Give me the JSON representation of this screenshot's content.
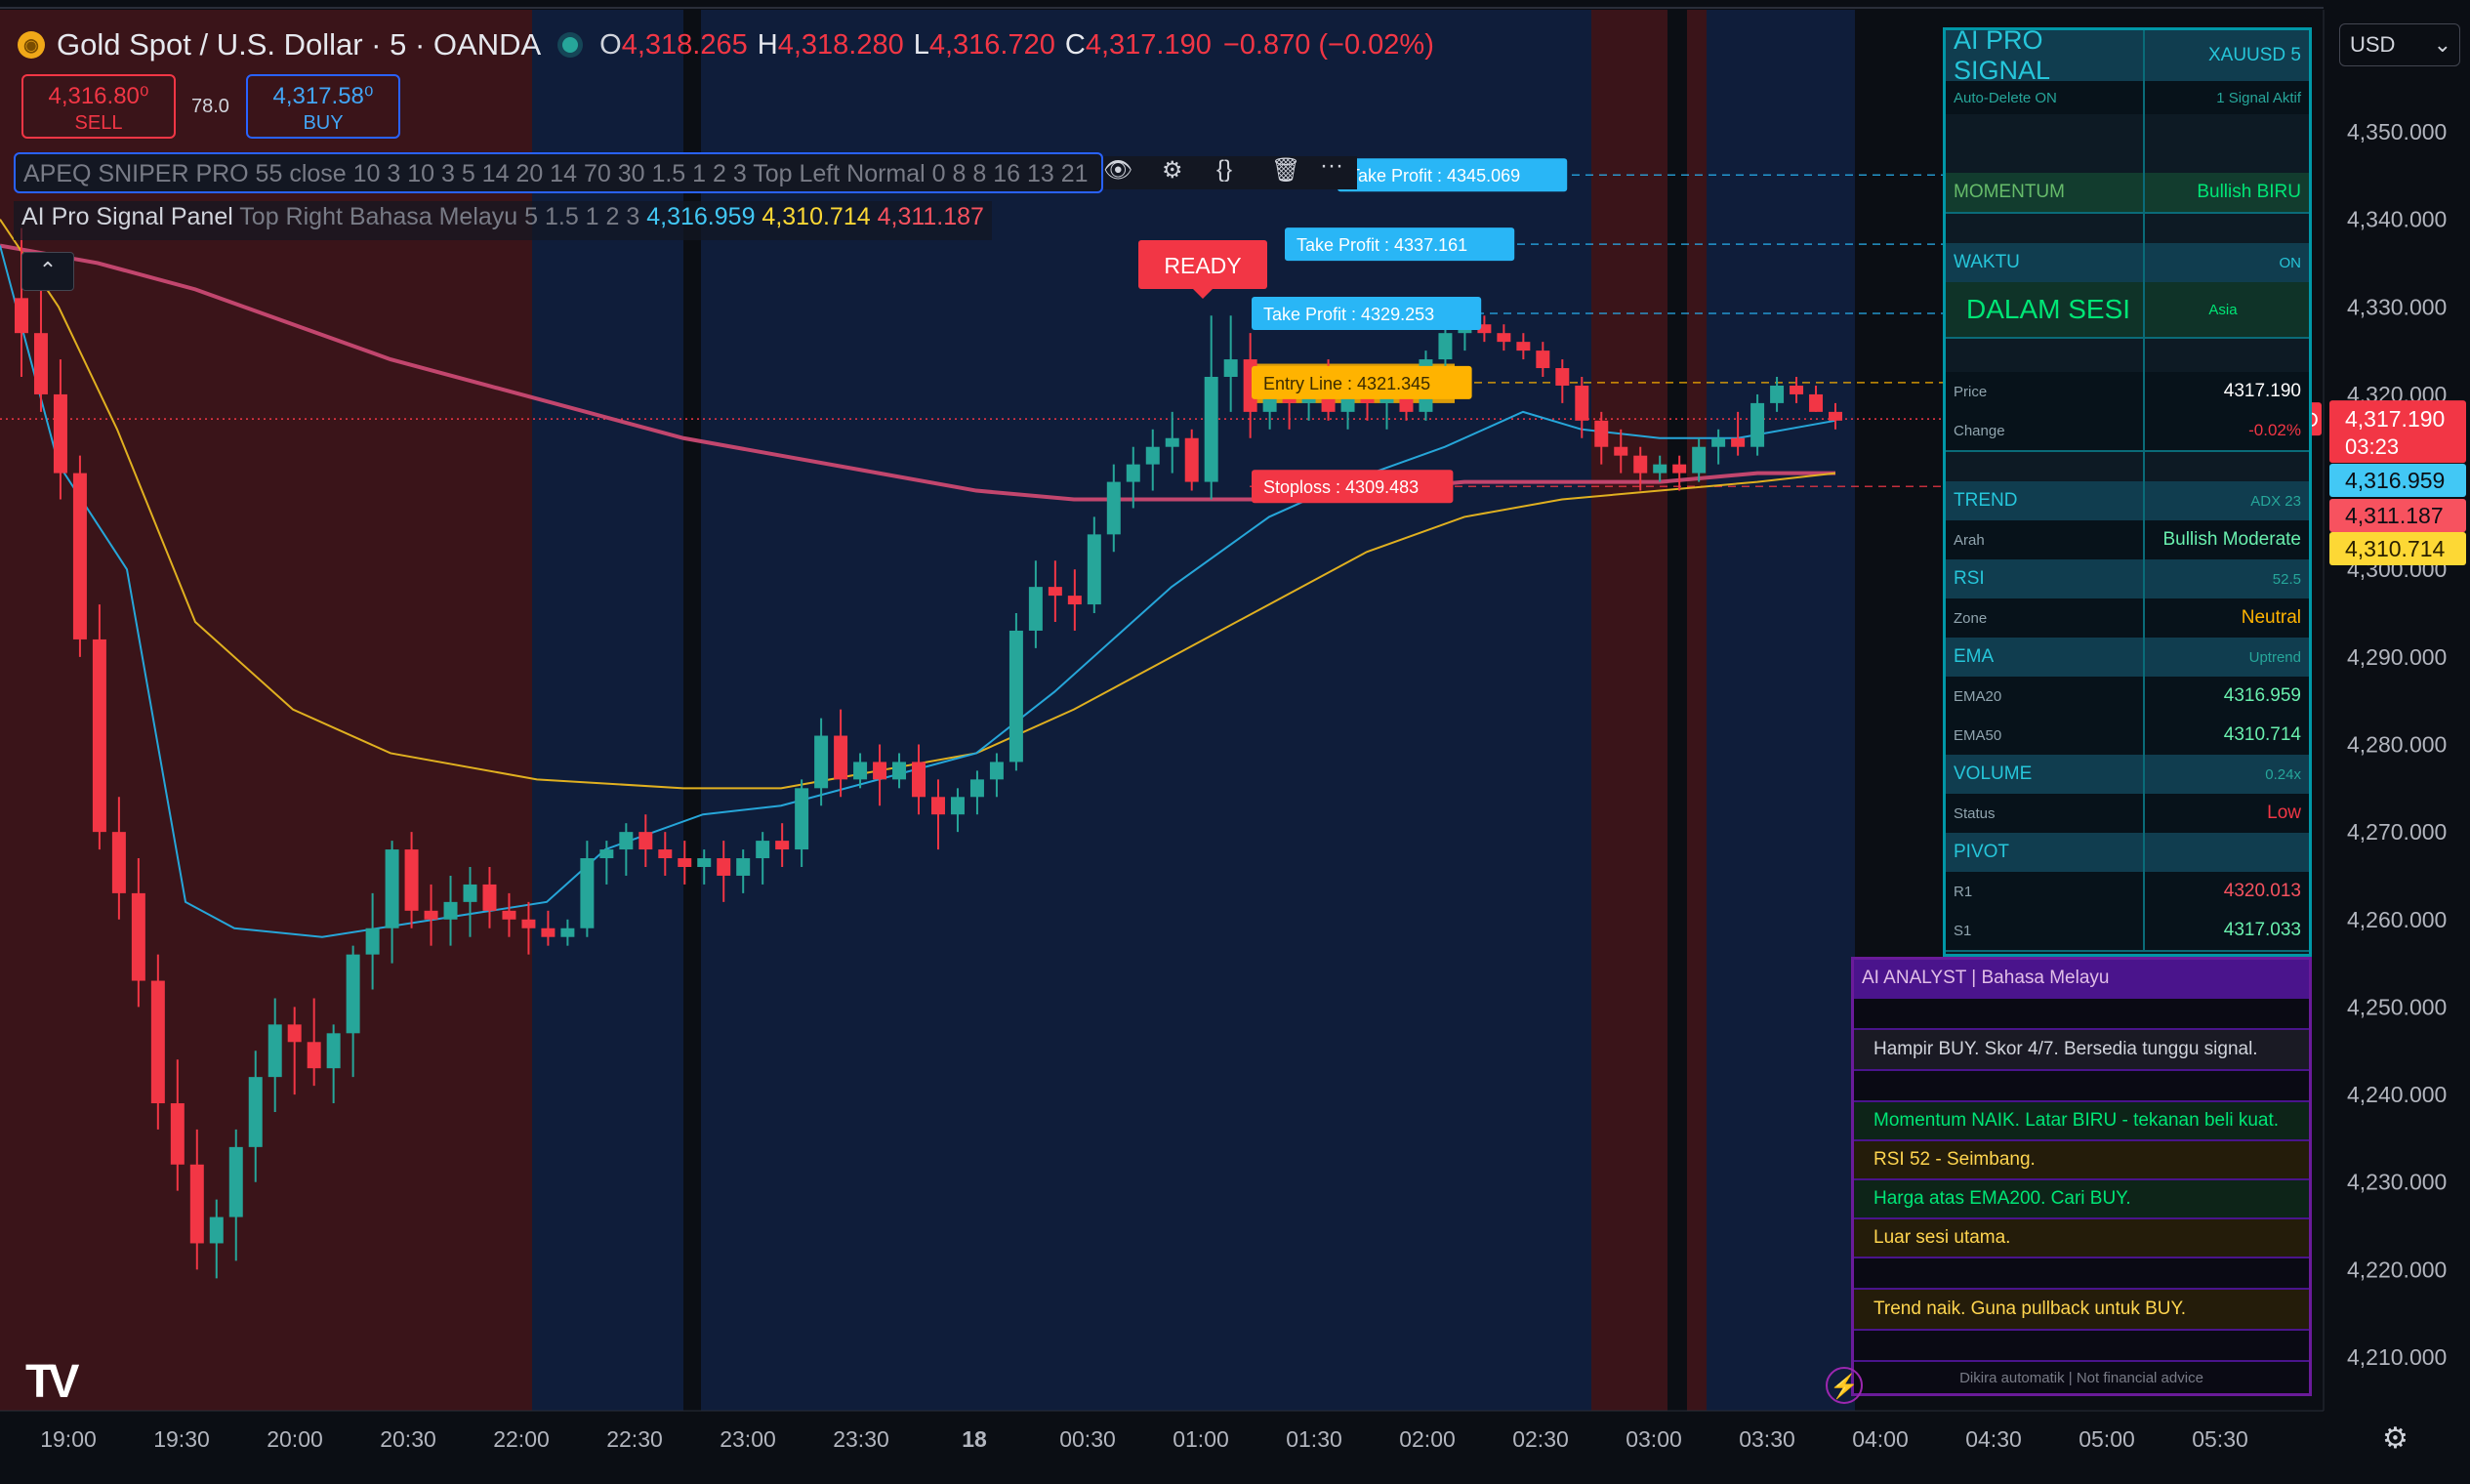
{
  "header": {
    "symbol": "Gold Spot / U.S. Dollar · 5 · OANDA",
    "open_label": "O",
    "open": "4,318.265",
    "high_label": "H",
    "high": "4,318.280",
    "low_label": "L",
    "low": "4,316.720",
    "close_label": "C",
    "close": "4,317.190",
    "change": "−0.870 (−0.02%)"
  },
  "trade": {
    "sell_price": "4,316.80⁰",
    "sell_label": "SELL",
    "spread": "78.0",
    "buy_price": "4,317.58⁰",
    "buy_label": "BUY"
  },
  "indicator1": {
    "text": "APEQ SNIPER PRO 55 close 10 3 10 3 5 14 20 14 70 30 1.5 1 2 3 Top Left Normal 0 8 8 16 13 21"
  },
  "indicator2": {
    "name": "AI Pro Signal Panel",
    "args": "Top Right Bahasa Melayu 5 1.5 1 2 3",
    "v1": "4,316.959",
    "v2": "4,310.714",
    "v3": "4,311.187"
  },
  "currency": "USD",
  "colors": {
    "up": "#26a69a",
    "down": "#f23645",
    "ema20": "#26a6d9",
    "ema50": "#e0b020",
    "ema200": "#c2466e",
    "sessionRed": "#3a1419",
    "sessionBlue": "#0f1d3a"
  },
  "chart_data": {
    "type": "candlestick",
    "symbol": "XAUUSD",
    "interval": "5",
    "ylim": [
      4203,
      4358
    ],
    "y_ticks": [
      "4,350.000",
      "4,340.000",
      "4,330.000",
      "4,320.000",
      "4,300.000",
      "4,290.000",
      "4,280.000",
      "4,270.000",
      "4,260.000",
      "4,250.000",
      "4,240.000",
      "4,230.000",
      "4,220.000",
      "4,210.000"
    ],
    "y_tick_values": [
      4350,
      4340,
      4330,
      4320,
      4300,
      4290,
      4280,
      4270,
      4260,
      4250,
      4240,
      4230,
      4220,
      4210
    ],
    "x_ticks": [
      "19:00",
      "19:30",
      "20:00",
      "20:30",
      "22:00",
      "22:30",
      "23:00",
      "23:30",
      "18",
      "00:30",
      "01:00",
      "01:30",
      "02:00",
      "02:30",
      "03:00",
      "03:30",
      "04:00",
      "04:30",
      "05:00",
      "05:30"
    ],
    "price_levels": [
      {
        "label": "Take Profit : 4345.069",
        "value": 4345.069
      },
      {
        "label": "Take Profit : 4337.161",
        "value": 4337.161
      },
      {
        "label": "Take Profit : 4329.253",
        "value": 4329.253
      },
      {
        "label": "Entry Line : 4321.345",
        "value": 4321.345
      },
      {
        "label": "Stoploss : 4309.483",
        "value": 4309.483
      }
    ],
    "ready_label": "READY",
    "price_tags": [
      {
        "label": "XAUUSD",
        "value": "4,317.190",
        "extra": "03:23",
        "color": "#f23645"
      },
      {
        "label": "",
        "value": "4,316.959",
        "color": "#42c8f5"
      },
      {
        "label": "",
        "value": "4,311.187",
        "color": "#f7525f"
      },
      {
        "label": "",
        "value": "4,310.714",
        "color": "#fdd835"
      }
    ],
    "candles": [
      [
        4331,
        4339,
        4322,
        4327
      ],
      [
        4327,
        4334,
        4318,
        4320
      ],
      [
        4320,
        4324,
        4308,
        4311
      ],
      [
        4311,
        4313,
        4290,
        4292
      ],
      [
        4292,
        4296,
        4268,
        4270
      ],
      [
        4270,
        4274,
        4260,
        4263
      ],
      [
        4263,
        4267,
        4250,
        4253
      ],
      [
        4253,
        4256,
        4236,
        4239
      ],
      [
        4239,
        4244,
        4229,
        4232
      ],
      [
        4232,
        4236,
        4220,
        4223
      ],
      [
        4223,
        4228,
        4219,
        4226
      ],
      [
        4226,
        4236,
        4221,
        4234
      ],
      [
        4234,
        4245,
        4230,
        4242
      ],
      [
        4242,
        4251,
        4238,
        4248
      ],
      [
        4248,
        4250,
        4240,
        4246
      ],
      [
        4246,
        4251,
        4241,
        4243
      ],
      [
        4243,
        4248,
        4239,
        4247
      ],
      [
        4247,
        4257,
        4242,
        4256
      ],
      [
        4256,
        4263,
        4252,
        4259
      ],
      [
        4259,
        4269,
        4255,
        4268
      ],
      [
        4268,
        4270,
        4259,
        4261
      ],
      [
        4261,
        4264,
        4257,
        4260
      ],
      [
        4260,
        4265,
        4257,
        4262
      ],
      [
        4262,
        4266,
        4258,
        4264
      ],
      [
        4264,
        4266,
        4259,
        4261
      ],
      [
        4261,
        4263,
        4258,
        4260
      ],
      [
        4260,
        4262,
        4256,
        4259
      ],
      [
        4259,
        4261,
        4257,
        4258
      ],
      [
        4258,
        4260,
        4257,
        4259
      ],
      [
        4259,
        4269,
        4258,
        4267
      ],
      [
        4267,
        4269,
        4264,
        4268
      ],
      [
        4268,
        4271,
        4265,
        4270
      ],
      [
        4270,
        4272,
        4266,
        4268
      ],
      [
        4268,
        4270,
        4265,
        4267
      ],
      [
        4267,
        4269,
        4264,
        4266
      ],
      [
        4266,
        4268,
        4264,
        4267
      ],
      [
        4267,
        4269,
        4262,
        4265
      ],
      [
        4265,
        4268,
        4263,
        4267
      ],
      [
        4267,
        4270,
        4264,
        4269
      ],
      [
        4269,
        4271,
        4266,
        4268
      ],
      [
        4268,
        4276,
        4266,
        4275
      ],
      [
        4275,
        4283,
        4273,
        4281
      ],
      [
        4281,
        4284,
        4274,
        4276
      ],
      [
        4276,
        4279,
        4275,
        4278
      ],
      [
        4278,
        4280,
        4273,
        4276
      ],
      [
        4276,
        4279,
        4275,
        4278
      ],
      [
        4278,
        4280,
        4272,
        4274
      ],
      [
        4274,
        4276,
        4268,
        4272
      ],
      [
        4272,
        4275,
        4270,
        4274
      ],
      [
        4274,
        4277,
        4272,
        4276
      ],
      [
        4276,
        4279,
        4274,
        4278
      ],
      [
        4278,
        4295,
        4277,
        4293
      ],
      [
        4293,
        4301,
        4291,
        4298
      ],
      [
        4298,
        4301,
        4294,
        4297
      ],
      [
        4297,
        4300,
        4293,
        4296
      ],
      [
        4296,
        4306,
        4295,
        4304
      ],
      [
        4304,
        4312,
        4302,
        4310
      ],
      [
        4310,
        4314,
        4307,
        4312
      ],
      [
        4312,
        4316,
        4309,
        4314
      ],
      [
        4314,
        4318,
        4311,
        4315
      ],
      [
        4315,
        4316,
        4309,
        4310
      ],
      [
        4310,
        4329,
        4308,
        4322
      ],
      [
        4322,
        4329,
        4318,
        4324
      ],
      [
        4324,
        4327,
        4315,
        4318
      ],
      [
        4318,
        4323,
        4316,
        4321
      ],
      [
        4321,
        4323,
        4316,
        4319
      ],
      [
        4319,
        4322,
        4317,
        4320
      ],
      [
        4320,
        4324,
        4317,
        4318
      ],
      [
        4318,
        4322,
        4316,
        4321
      ],
      [
        4321,
        4323,
        4317,
        4319
      ],
      [
        4319,
        4321,
        4316,
        4320
      ],
      [
        4320,
        4322,
        4317,
        4318
      ],
      [
        4318,
        4325,
        4317,
        4324
      ],
      [
        4324,
        4329,
        4322,
        4327
      ],
      [
        4327,
        4330,
        4325,
        4328
      ],
      [
        4328,
        4329,
        4326,
        4327
      ],
      [
        4327,
        4328,
        4325,
        4326
      ],
      [
        4326,
        4327,
        4324,
        4325
      ],
      [
        4325,
        4326,
        4322,
        4323
      ],
      [
        4323,
        4324,
        4319,
        4321
      ],
      [
        4321,
        4322,
        4315,
        4317
      ],
      [
        4317,
        4318,
        4312,
        4314
      ],
      [
        4314,
        4316,
        4311,
        4313
      ],
      [
        4313,
        4314,
        4309,
        4311
      ],
      [
        4311,
        4313,
        4310,
        4312
      ],
      [
        4312,
        4313,
        4309,
        4311
      ],
      [
        4311,
        4315,
        4310,
        4314
      ],
      [
        4314,
        4316,
        4312,
        4315
      ],
      [
        4315,
        4318,
        4313,
        4314
      ],
      [
        4314,
        4320,
        4313,
        4319
      ],
      [
        4319,
        4322,
        4318,
        4321
      ],
      [
        4321,
        4322,
        4319,
        4320
      ],
      [
        4320,
        4321,
        4318,
        4318
      ],
      [
        4318,
        4319,
        4316,
        4317
      ]
    ],
    "ema20": [
      [
        0,
        4337
      ],
      [
        60,
        4312
      ],
      [
        130,
        4300
      ],
      [
        190,
        4262
      ],
      [
        240,
        4259
      ],
      [
        330,
        4258
      ],
      [
        560,
        4262
      ],
      [
        620,
        4268
      ],
      [
        720,
        4272
      ],
      [
        800,
        4273
      ],
      [
        900,
        4276
      ],
      [
        1000,
        4279
      ],
      [
        1080,
        4286
      ],
      [
        1200,
        4298
      ],
      [
        1300,
        4306
      ],
      [
        1380,
        4310
      ],
      [
        1480,
        4314
      ],
      [
        1560,
        4318
      ],
      [
        1620,
        4316
      ],
      [
        1700,
        4315
      ],
      [
        1780,
        4315
      ],
      [
        1880,
        4317
      ]
    ],
    "ema50": [
      [
        0,
        4340
      ],
      [
        60,
        4330
      ],
      [
        120,
        4316
      ],
      [
        200,
        4294
      ],
      [
        300,
        4284
      ],
      [
        400,
        4279
      ],
      [
        550,
        4276
      ],
      [
        700,
        4275
      ],
      [
        800,
        4275
      ],
      [
        900,
        4277
      ],
      [
        1000,
        4279
      ],
      [
        1100,
        4284
      ],
      [
        1200,
        4290
      ],
      [
        1300,
        4296
      ],
      [
        1400,
        4302
      ],
      [
        1500,
        4306
      ],
      [
        1600,
        4308
      ],
      [
        1700,
        4309
      ],
      [
        1800,
        4310
      ],
      [
        1880,
        4311
      ]
    ],
    "ema200": [
      [
        0,
        4337
      ],
      [
        100,
        4335
      ],
      [
        200,
        4332
      ],
      [
        300,
        4328
      ],
      [
        400,
        4324
      ],
      [
        500,
        4321
      ],
      [
        600,
        4318
      ],
      [
        700,
        4315
      ],
      [
        800,
        4313
      ],
      [
        900,
        4311
      ],
      [
        1000,
        4309
      ],
      [
        1100,
        4308
      ],
      [
        1200,
        4308
      ],
      [
        1300,
        4308
      ],
      [
        1400,
        4309
      ],
      [
        1500,
        4310
      ],
      [
        1600,
        4310
      ],
      [
        1700,
        4310
      ],
      [
        1800,
        4311
      ],
      [
        1880,
        4311
      ]
    ]
  },
  "signal_panel": {
    "title": "AI PRO SIGNAL",
    "symbol": "XAUUSD 5",
    "auto_delete": "Auto-Delete ON",
    "signal_count": "1 Signal Aktif",
    "momentum_label": "MOMENTUM",
    "momentum_value": "Bullish BIRU",
    "waktu_label": "WAKTU",
    "waktu_value": "ON",
    "session_status": "DALAM SESI",
    "session_name": "Asia",
    "price_label": "Price",
    "price_value": "4317.190",
    "change_label": "Change",
    "change_value": "-0.02%",
    "trend_label": "TREND",
    "trend_value": "ADX 23",
    "arah_label": "Arah",
    "arah_value": "Bullish Moderate",
    "rsi_label": "RSI",
    "rsi_value": "52.5",
    "zone_label": "Zone",
    "zone_value": "Neutral",
    "ema_label": "EMA",
    "ema_value": "Uptrend",
    "ema20_label": "EMA20",
    "ema20_value": "4316.959",
    "ema50_label": "EMA50",
    "ema50_value": "4310.714",
    "volume_label": "VOLUME",
    "volume_value": "0.24x",
    "status_label": "Status",
    "status_value": "Low",
    "pivot_label": "PIVOT",
    "r1_label": "R1",
    "r1_value": "4320.013",
    "s1_label": "S1",
    "s1_value": "4317.033"
  },
  "analyst_panel": {
    "title": "AI ANALYST | Bahasa Melayu",
    "line1": "Hampir BUY. Skor 4/7. Bersedia tunggu signal.",
    "line2": "Momentum NAIK. Latar BIRU - tekanan beli kuat.",
    "line3": "RSI 52 - Seimbang.",
    "line4": "Harga atas EMA200. Cari BUY.",
    "line5": "Luar sesi utama.",
    "line6": "Trend naik. Guna pullback untuk BUY.",
    "footer": "Dikira automatik | Not financial advice"
  }
}
